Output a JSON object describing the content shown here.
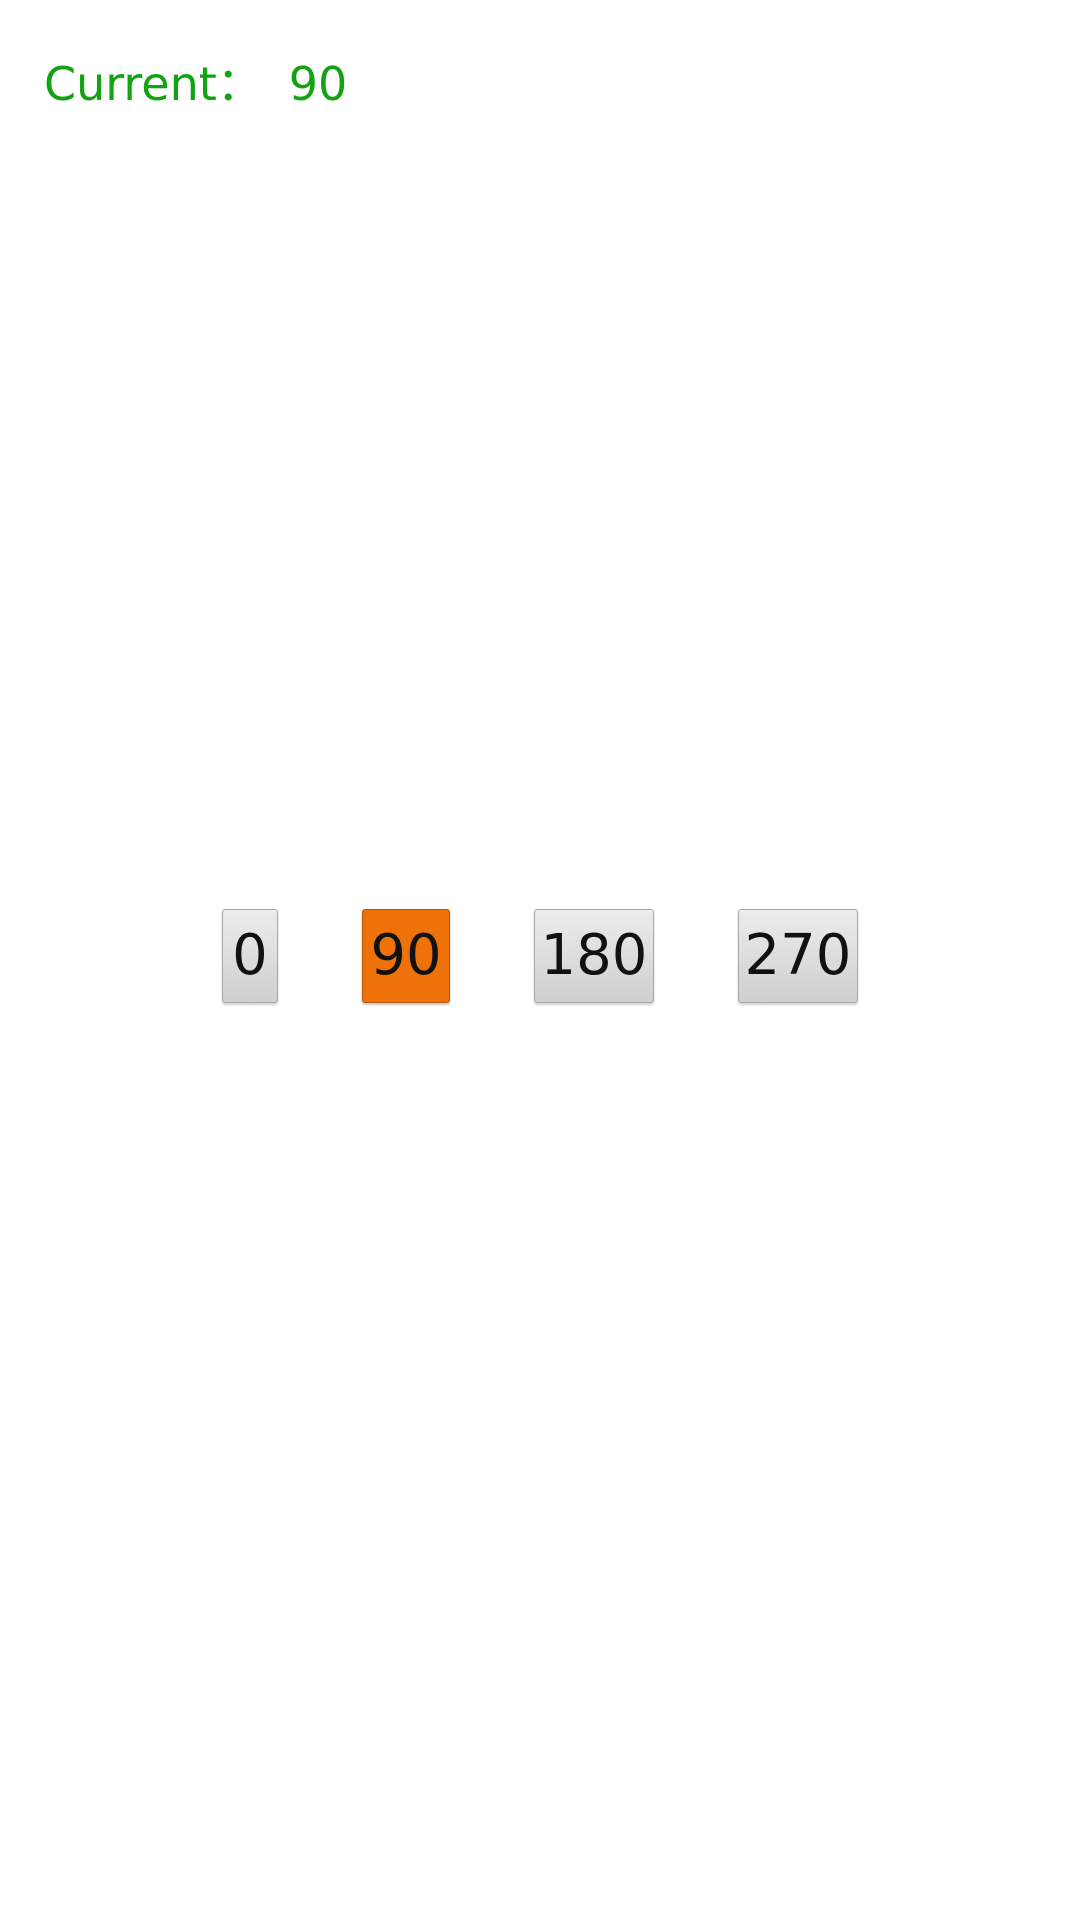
{
  "status": {
    "label": "Current：",
    "value": "90"
  },
  "colors": {
    "status_text": "#12a312",
    "selected_button": "#ef7208",
    "button_face": "#dcdcdc"
  },
  "buttons": [
    {
      "label": "0",
      "selected": false
    },
    {
      "label": "90",
      "selected": true
    },
    {
      "label": "180",
      "selected": false
    },
    {
      "label": "270",
      "selected": false
    }
  ]
}
